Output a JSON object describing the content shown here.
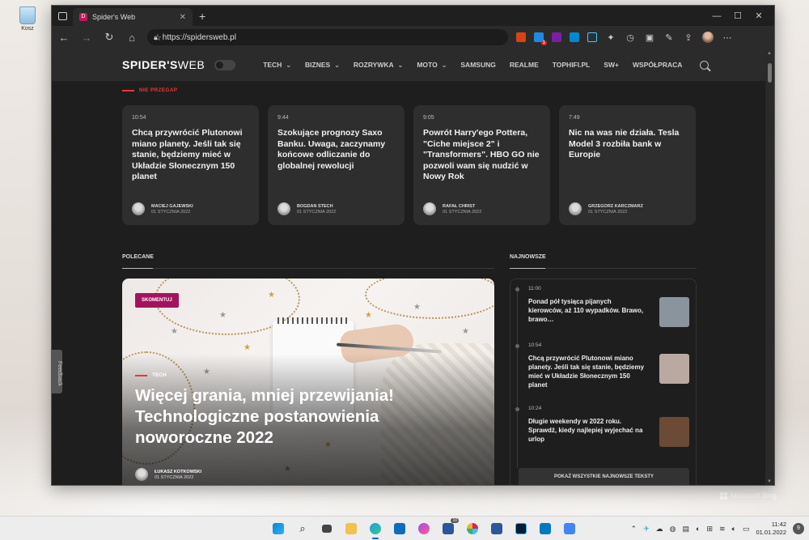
{
  "desktop": {
    "recycle_label": "Kosz",
    "bing_watermark": "Microsoft Bing",
    "feedback_tab": "Feedback"
  },
  "browser": {
    "tab_title": "Spider's Web",
    "tab_favicon_letter": "D",
    "url": "https://spidersweb.pl",
    "extension_badge": "1"
  },
  "site": {
    "logo_bold": "SPIDER'S",
    "logo_light": "WEB",
    "menu": [
      {
        "label": "TECH",
        "dropdown": true
      },
      {
        "label": "BIZNES",
        "dropdown": true
      },
      {
        "label": "ROZRYWKA",
        "dropdown": true
      },
      {
        "label": "MOTO",
        "dropdown": true
      },
      {
        "label": "SAMSUNG",
        "dropdown": false
      },
      {
        "label": "REALME",
        "dropdown": false
      },
      {
        "label": "TOPHIFI.PL",
        "dropdown": false
      },
      {
        "label": "SW+",
        "dropdown": false
      },
      {
        "label": "WSPÓŁPRACA",
        "dropdown": false
      }
    ],
    "dont_miss_label": "NIE PRZEGAP",
    "cards": [
      {
        "time": "10:54",
        "headline": "Chcą przywrócić Plutonowi miano planety. Jeśli tak się stanie, będziemy mieć w Układzie Słonecznym 150 planet",
        "author": "MACIEJ GAJEWSKI",
        "date": "01 STYCZNIA 2022"
      },
      {
        "time": "9:44",
        "headline": "Szokujące prognozy Saxo Banku. Uwaga, zaczynamy końcowe odliczanie do globalnej rewolucji",
        "author": "BOGDAN STECH",
        "date": "01 STYCZNIA 2022"
      },
      {
        "time": "9:05",
        "headline": "Powrót Harry'ego Pottera, \"Ciche miejsce 2\" i \"Transformers\". HBO GO nie pozwoli wam się nudzić w Nowy Rok",
        "author": "RAFAŁ CHRIST",
        "date": "01 STYCZNIA 2022"
      },
      {
        "time": "7:49",
        "headline": "Nic na was nie działa. Tesla Model 3 rozbiła bank w Europie",
        "author": "GRZEGORZ KARCZMARZ",
        "date": "01 STYCZNIA 2022"
      }
    ],
    "recommended_label": "POLECANE",
    "latest_label": "NAJNOWSZE",
    "hero": {
      "badge": "SKOMENTUJ",
      "tag": "TECH",
      "title": "Więcej grania, mniej przewijania! Technologiczne postanowienia noworoczne 2022",
      "author": "ŁUKASZ KOTKOWSKI",
      "date": "01 STYCZNIA 2022"
    },
    "latest": [
      {
        "time": "11:00",
        "title": "Ponad pół tysiąca pijanych kierowców, aż 110 wypadków. Brawo, brawo…",
        "thumb_color": "#8a949c"
      },
      {
        "time": "10:54",
        "title": "Chcą przywrócić Plutonowi miano planety. Jeśli tak się stanie, będziemy mieć w Układzie Słonecznym 150 planet",
        "thumb_color": "#b9a9a0"
      },
      {
        "time": "10:24",
        "title": "Długie weekendy w 2022 roku. Sprawdź, kiedy najlepiej wyjechać na urlop",
        "thumb_color": "#6b4a36"
      }
    ],
    "show_all_latest": "POKAŻ WSZYSTKIE NAJNOWSZE TEKSTY"
  },
  "taskbar": {
    "time": "11:42",
    "date": "01.01.2022",
    "notifications": "9",
    "store_badge": "10"
  }
}
